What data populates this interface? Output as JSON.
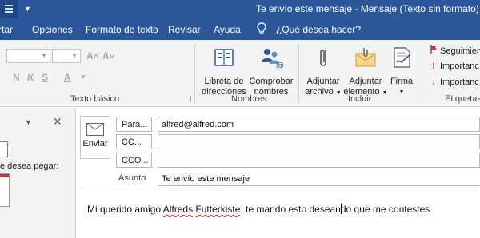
{
  "window": {
    "title": "Te envío este mensaje  -  Mensaje (Texto sin formato)"
  },
  "tabs": [
    {
      "label": "rtar"
    },
    {
      "label": "Opciones"
    },
    {
      "label": "Formato de texto"
    },
    {
      "label": "Revisar"
    },
    {
      "label": "Ayuda"
    }
  ],
  "tell_me": {
    "label": "¿Qué desea hacer?",
    "icon": "lightbulb-icon"
  },
  "ribbon": {
    "basic_text": {
      "label": "Texto básico",
      "format_glyphs": {
        "grow": "A˄",
        "shrink": "A˅",
        "clear": "A",
        "bold": "N",
        "italic": "K",
        "underline": "S",
        "font_color": "A"
      }
    },
    "names": {
      "label": "Nombres",
      "address_book": {
        "line1": "Libreta de",
        "line2": "direcciones",
        "icon": "address-book-icon"
      },
      "check_names": {
        "line1": "Comprobar",
        "line2": "nombres",
        "icon": "check-names-icon"
      }
    },
    "include": {
      "label": "Incluir",
      "attach_file": {
        "line1": "Adjuntar",
        "line2": "archivo",
        "icon": "paperclip-icon"
      },
      "attach_item": {
        "line1": "Adjuntar",
        "line2": "elemento",
        "icon": "envelope-attach-icon"
      },
      "signature": {
        "line1": "Firma",
        "icon": "signature-icon"
      }
    },
    "tags": {
      "label": "Etiquetas",
      "follow_up": {
        "label": "Seguimien",
        "color": "#c0392b"
      },
      "high_importance": {
        "label": "Importanc",
        "mark": "!",
        "color": "#c0392b"
      },
      "low_importance": {
        "label": "Importanc",
        "mark": "↓",
        "color": "#2b579a"
      }
    }
  },
  "left_panel": {
    "paste_prompt": "e desea pegar:"
  },
  "compose": {
    "send_label": "Enviar",
    "to_label": "Para...",
    "to_value": "alfred@alfred.com",
    "cc_label": "CC...",
    "cc_value": "",
    "bcc_label": "CCO...",
    "bcc_value": "",
    "subject_label": "Asunto",
    "subject_value": "Te envío este mensaje",
    "body": {
      "part1": "Mi querido amigo ",
      "misspelled1": "Alfreds",
      "space": " ",
      "misspelled2": "Futterkiste",
      "part2": ", te mando esto desean",
      "part3": "do que me contestes"
    }
  },
  "colors": {
    "accent": "#2b579a",
    "ribbon_bg": "#f3f3f3",
    "flag_red": "#c0392b"
  }
}
